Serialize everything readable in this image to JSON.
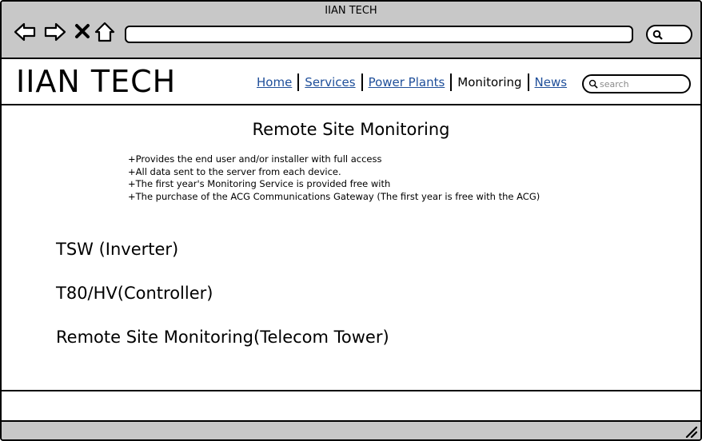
{
  "browser": {
    "window_title": "IIAN TECH",
    "url": ""
  },
  "site": {
    "logo": "IIAN TECH",
    "nav": [
      {
        "label": "Home",
        "active": false
      },
      {
        "label": "Services",
        "active": false
      },
      {
        "label": "Power Plants",
        "active": false
      },
      {
        "label": "Monitoring",
        "active": true
      },
      {
        "label": "News",
        "active": false
      }
    ],
    "search_placeholder": "search"
  },
  "content": {
    "title": "Remote Site Monitoring",
    "bullets": [
      "+Provides the end user and/or installer with full access",
      "+All data sent to the server from each device.",
      "+The first year's Monitoring Service is provided free with",
      "+The purchase of the ACG Communications Gateway (The first year is free with the ACG)"
    ],
    "sections": [
      "TSW (Inverter)",
      "T80/HV(Controller)",
      "Remote Site Monitoring(Telecom Tower)"
    ]
  },
  "colors": {
    "chrome": "#c8c8c8",
    "link": "#1f4f9a"
  },
  "icons": [
    "back-arrow-icon",
    "forward-arrow-icon",
    "close-icon",
    "home-icon",
    "search-icon",
    "resize-grip-icon"
  ]
}
